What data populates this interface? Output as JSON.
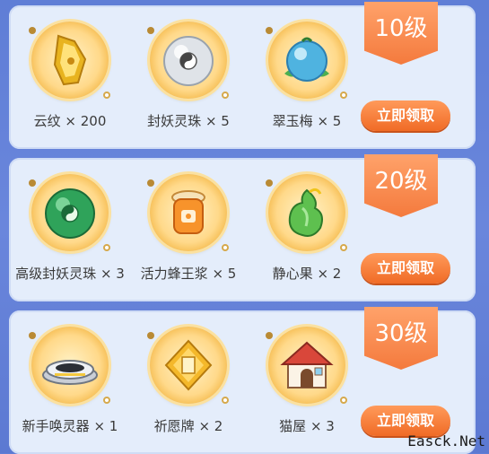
{
  "panels": [
    {
      "level": "10级",
      "claim_label": "立即领取",
      "items": [
        {
          "label": "云纹 × 200",
          "icon": "cloud-pattern-icon"
        },
        {
          "label": "封妖灵珠 × 5",
          "icon": "white-spirit-pearl-icon"
        },
        {
          "label": "翠玉梅 × 5",
          "icon": "jade-plum-icon"
        }
      ]
    },
    {
      "level": "20级",
      "claim_label": "立即领取",
      "items": [
        {
          "label": "高级封妖灵珠 × 3",
          "icon": "green-spirit-pearl-icon"
        },
        {
          "label": "活力蜂王浆 × 5",
          "icon": "royal-jelly-jar-icon"
        },
        {
          "label": "静心果 × 2",
          "icon": "calm-fruit-icon"
        }
      ]
    },
    {
      "level": "30级",
      "claim_label": "立即领取",
      "items": [
        {
          "label": "新手唤灵器 × 1",
          "icon": "summoner-device-icon"
        },
        {
          "label": "祈愿牌 × 2",
          "icon": "wish-plaque-icon"
        },
        {
          "label": "猫屋 × 3",
          "icon": "cat-house-icon"
        }
      ]
    }
  ],
  "watermark": "Easck.Net"
}
